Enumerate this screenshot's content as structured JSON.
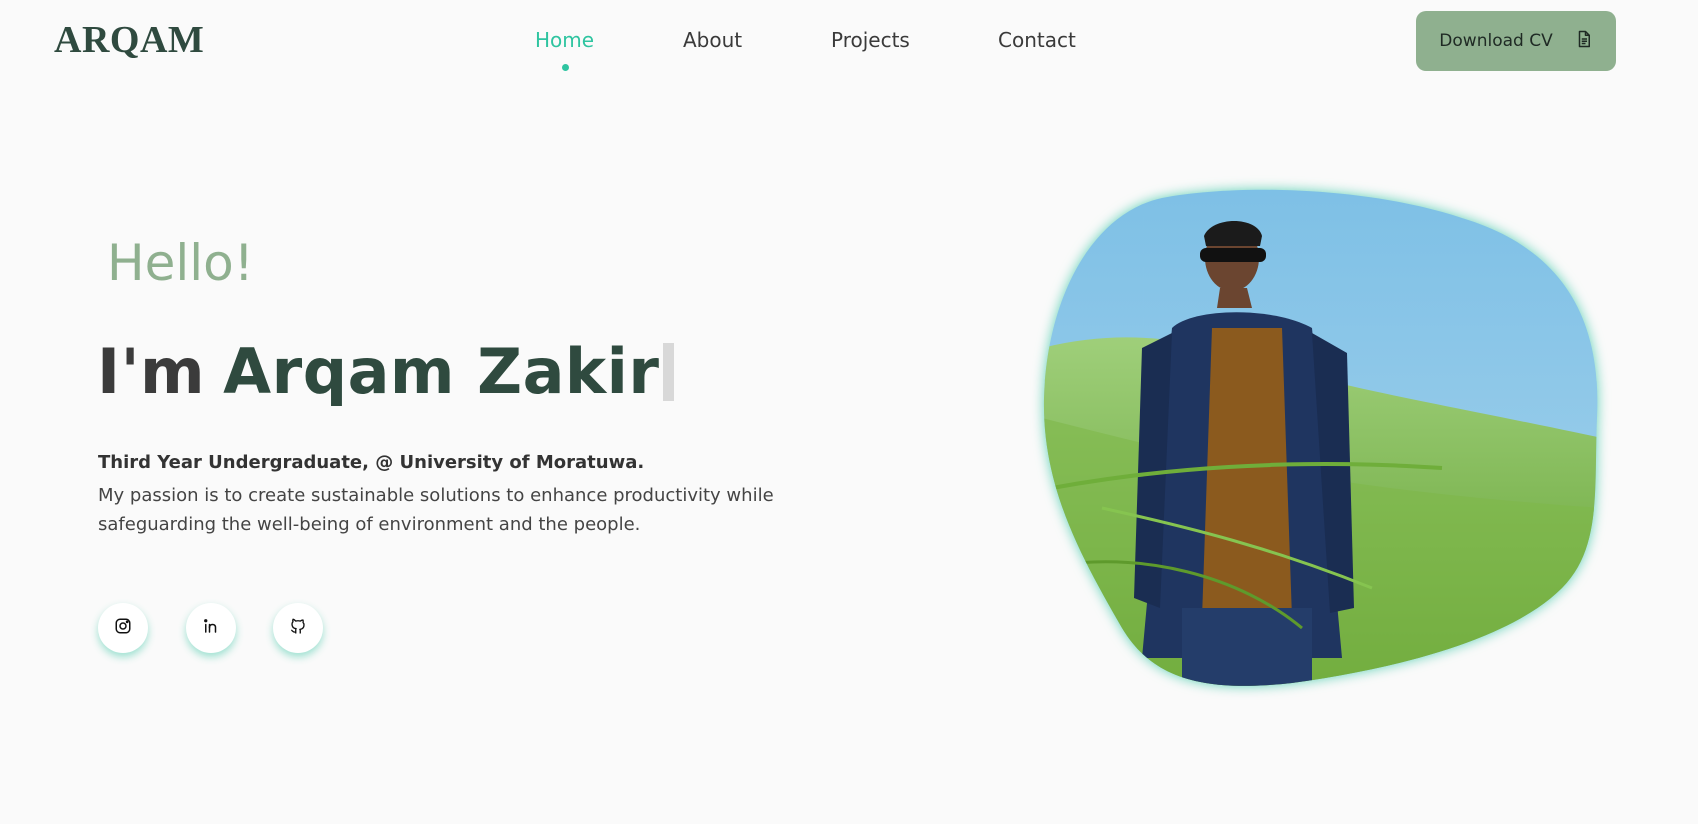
{
  "brand": {
    "logo": "ARQAM"
  },
  "nav": {
    "items": [
      {
        "label": "Home",
        "active": true
      },
      {
        "label": "About",
        "active": false
      },
      {
        "label": "Projects",
        "active": false
      },
      {
        "label": "Contact",
        "active": false
      }
    ]
  },
  "header": {
    "cv_button": {
      "label": "Download CV",
      "icon": "document-icon"
    }
  },
  "hero": {
    "greeting": "Hello!",
    "intro_prefix": "I'm",
    "name": "Arqam Zakir",
    "subtitle": "Third Year Undergraduate, @ University of Moratuwa.",
    "description": "My passion is to create sustainable solutions to enhance productivity while safeguarding the well-being of environment and the people."
  },
  "social": [
    {
      "icon": "instagram-icon"
    },
    {
      "icon": "linkedin-icon"
    },
    {
      "icon": "github-icon"
    }
  ],
  "colors": {
    "accent": "#2ec4a0",
    "brand_dark": "#2f4a3f",
    "sage": "#8fb08f",
    "background": "#fafafa"
  }
}
